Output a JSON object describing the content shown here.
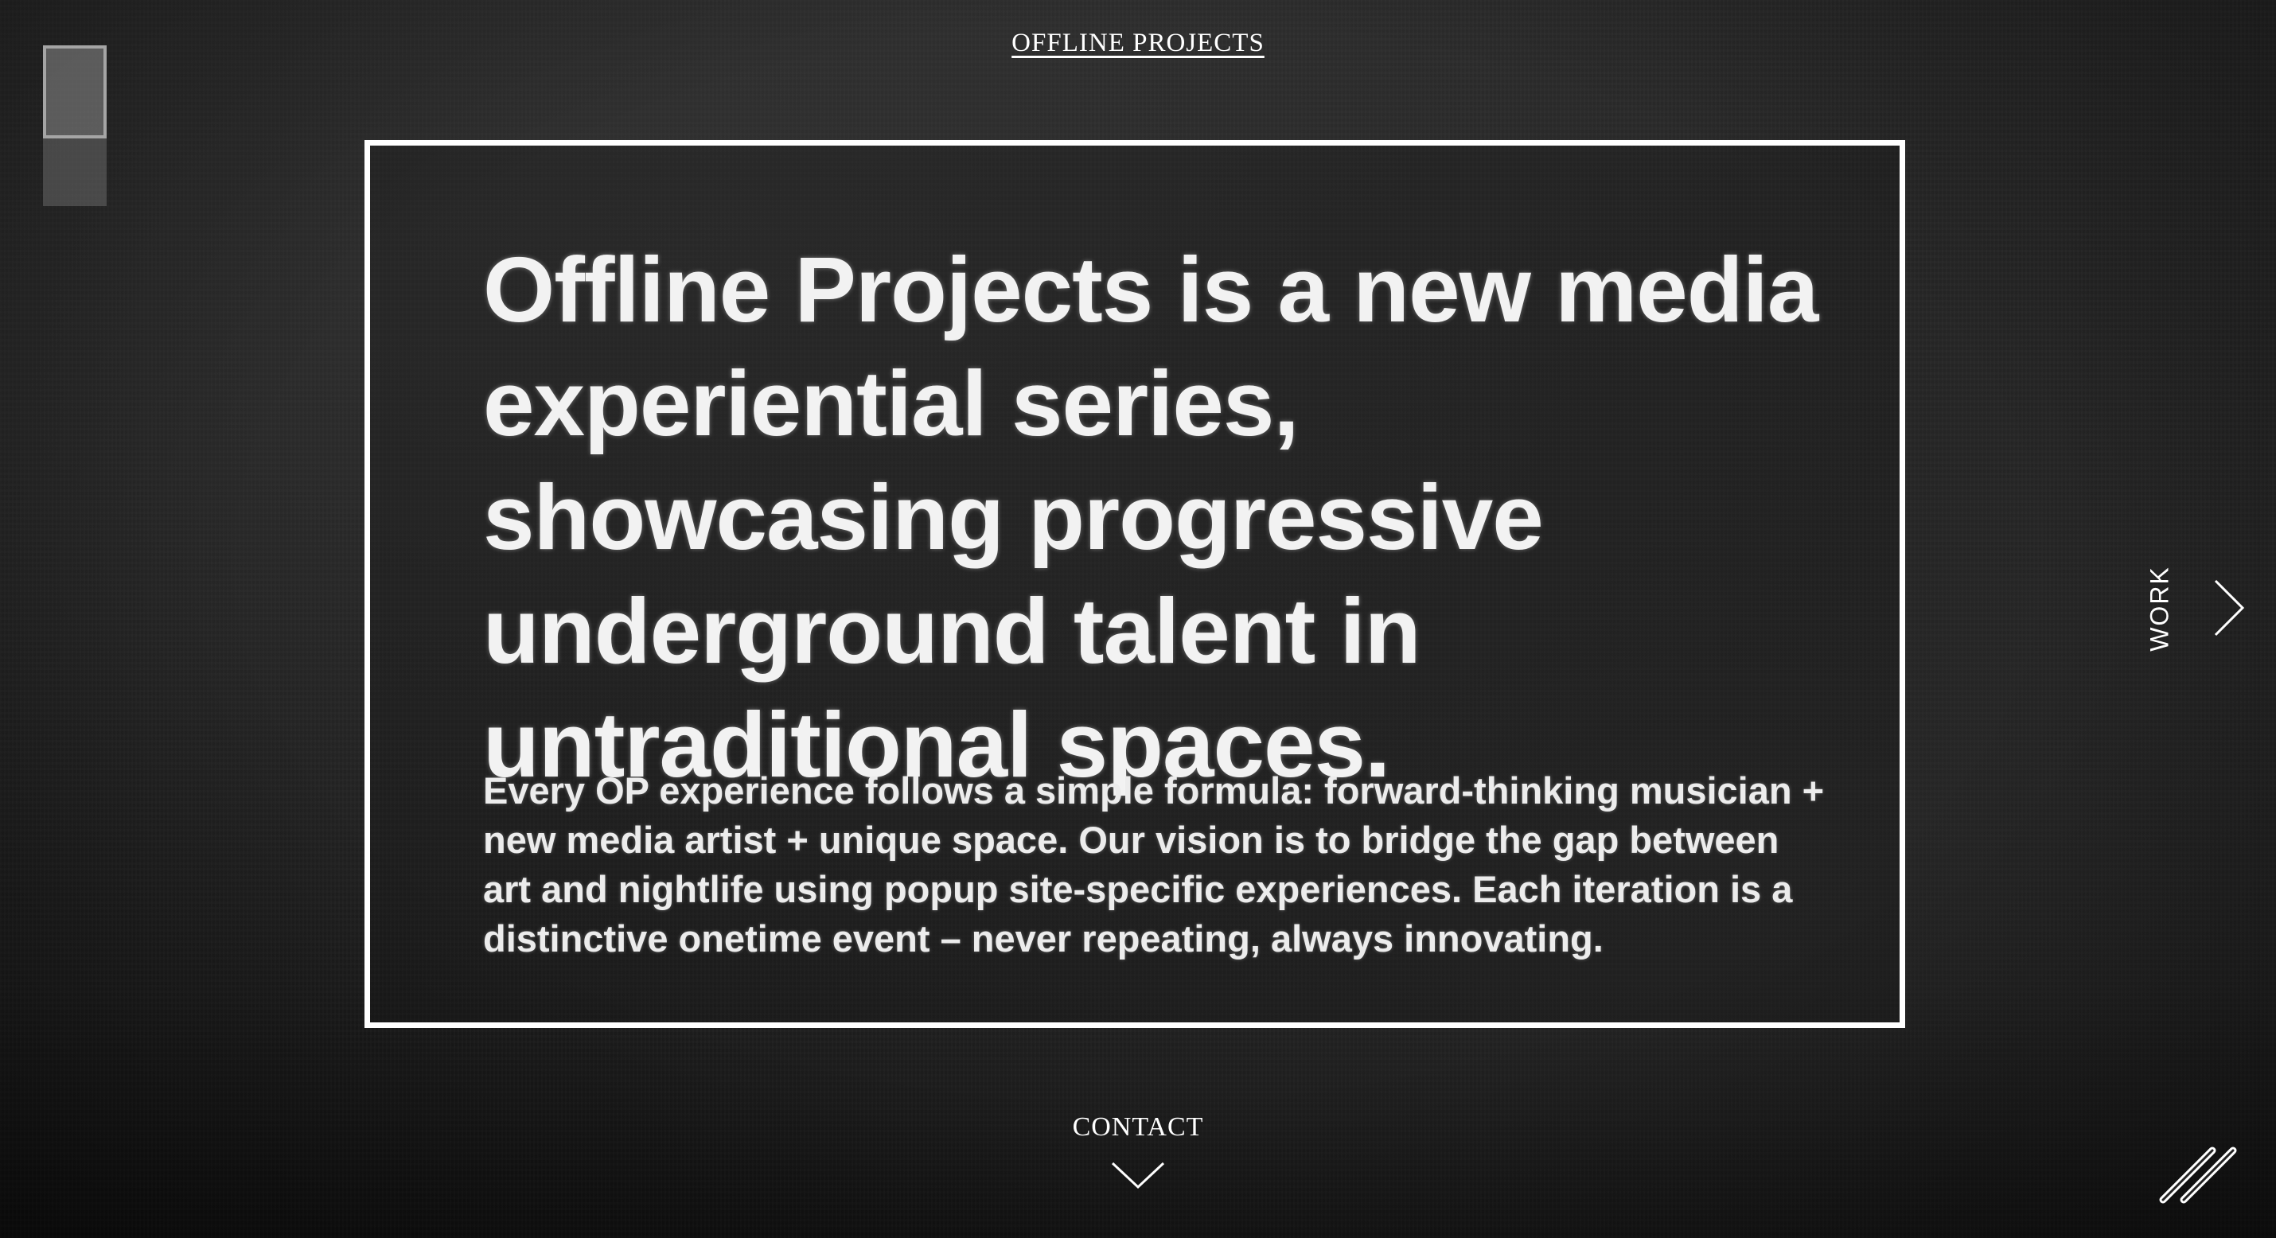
{
  "header": {
    "brand_link": "OFFLINE PROJECTS"
  },
  "slides": {
    "count": 2,
    "active_index": 0
  },
  "main": {
    "headline": "Offline Projects is a new media experiential series, showcasing progressive underground talent in untraditional spaces.",
    "body": "Every OP experience follows a simple formula: forward-thinking musician + new media artist + unique space. Our vision is to bridge the gap between art and nightlife using popup site-specific experiences. Each iteration is a distinctive onetime event – never repeating, always innovating."
  },
  "nav": {
    "work_label": "WORK",
    "work_icon": "chevron-right-icon",
    "contact_label": "CONTACT",
    "contact_icon": "chevron-down-icon",
    "logo_icon": "double-slash-logo-icon"
  },
  "colors": {
    "background": "#232323",
    "text": "#ffffff",
    "frame_border": "#ffffff"
  }
}
